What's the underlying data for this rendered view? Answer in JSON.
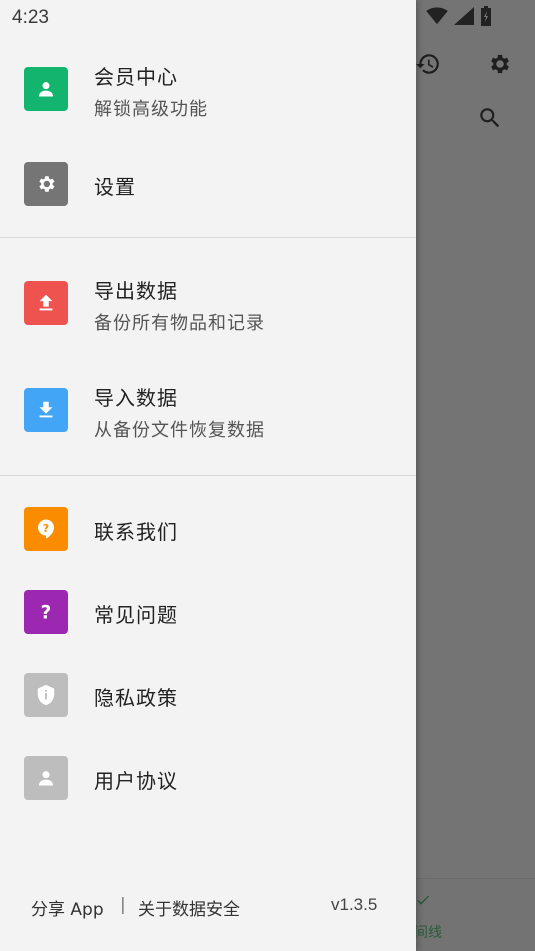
{
  "status_bar": {
    "time": "4:23"
  },
  "background": {
    "nav_partial_label": "间线",
    "icons": [
      "history-icon",
      "gear-icon",
      "search-icon",
      "check-icon"
    ]
  },
  "drawer": {
    "groups": [
      [
        {
          "key": "membership",
          "title": "会员中心",
          "subtitle": "解锁高级功能",
          "color": "#13b56e",
          "icon": "person-icon"
        },
        {
          "key": "settings",
          "title": "设置",
          "subtitle": "",
          "color": "#757575",
          "icon": "gear-icon"
        }
      ],
      [
        {
          "key": "export",
          "title": "导出数据",
          "subtitle": "备份所有物品和记录",
          "color": "#ef5350",
          "icon": "upload-icon"
        },
        {
          "key": "import",
          "title": "导入数据",
          "subtitle": "从备份文件恢复数据",
          "color": "#42a5f5",
          "icon": "download-icon"
        }
      ],
      [
        {
          "key": "contact",
          "title": "联系我们",
          "subtitle": "",
          "color": "#fb8c00",
          "icon": "feedback-icon"
        },
        {
          "key": "faq",
          "title": "常见问题",
          "subtitle": "",
          "color": "#9c27b0",
          "icon": "question-icon"
        },
        {
          "key": "privacy",
          "title": "隐私政策",
          "subtitle": "",
          "color": "#bdbdbd",
          "icon": "shield-icon"
        },
        {
          "key": "agreement",
          "title": "用户协议",
          "subtitle": "",
          "color": "#bdbdbd",
          "icon": "person-icon"
        }
      ]
    ],
    "footer": {
      "share": "分享 App",
      "separator": "|",
      "data_safety": "关于数据安全",
      "version": "v1.3.5"
    }
  }
}
